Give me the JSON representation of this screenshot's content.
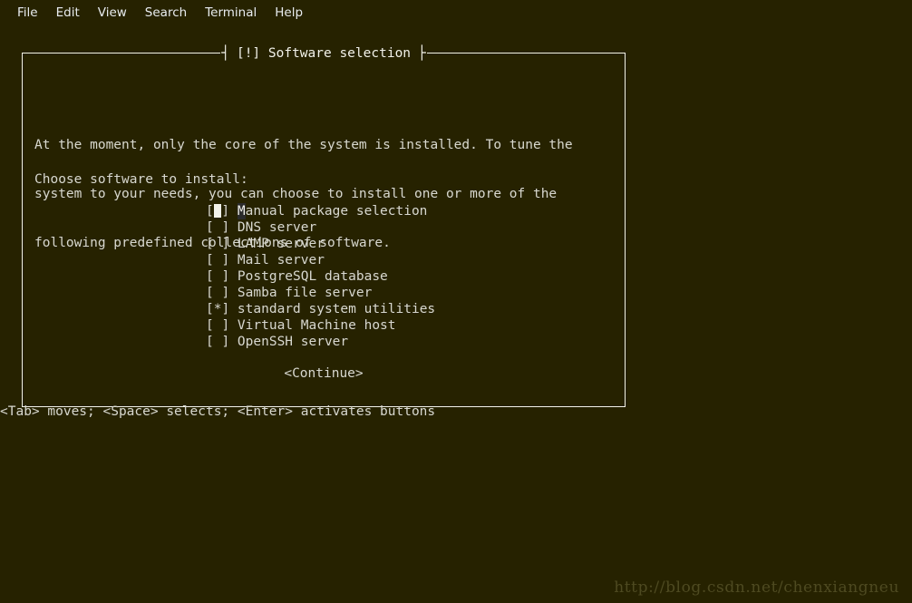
{
  "window": {
    "background_color": "#262200",
    "foreground_color": "#d8d8d0"
  },
  "menubar": {
    "items": [
      {
        "label": "File"
      },
      {
        "label": "Edit"
      },
      {
        "label": "View"
      },
      {
        "label": "Search"
      },
      {
        "label": "Terminal"
      },
      {
        "label": "Help"
      }
    ]
  },
  "dialog": {
    "title": "[!] Software selection",
    "title_left_cap": "┤",
    "title_right_cap": "├",
    "border_color": "#f2f2ea",
    "paragraph": [
      "At the moment, only the core of the system is installed. To tune the",
      "system to your needs, you can choose to install one or more of the",
      "following predefined collections of software."
    ],
    "prompt": "Choose software to install:",
    "choices": [
      {
        "checked": false,
        "label": "Manual package selection",
        "cursor": true,
        "hotkey": "M",
        "rest": "anual package selection"
      },
      {
        "checked": false,
        "label": "DNS server",
        "cursor": false
      },
      {
        "checked": false,
        "label": "LAMP server",
        "cursor": false
      },
      {
        "checked": false,
        "label": "Mail server",
        "cursor": false
      },
      {
        "checked": false,
        "label": "PostgreSQL database",
        "cursor": false
      },
      {
        "checked": false,
        "label": "Samba file server",
        "cursor": false
      },
      {
        "checked": true,
        "label": "standard system utilities",
        "cursor": false
      },
      {
        "checked": false,
        "label": "Virtual Machine host",
        "cursor": false
      },
      {
        "checked": false,
        "label": "OpenSSH server",
        "cursor": false
      }
    ],
    "checkbox_unchecked": "[ ] ",
    "checkbox_checked": "[*] ",
    "checkbox_open": "[",
    "checkbox_close": "] ",
    "continue_button": "<Continue>"
  },
  "help_line": "<Tab> moves; <Space> selects; <Enter> activates buttons",
  "watermark": {
    "text": "http://blog.csdn.net/chenxiangneu",
    "color": "#4e4a21"
  }
}
